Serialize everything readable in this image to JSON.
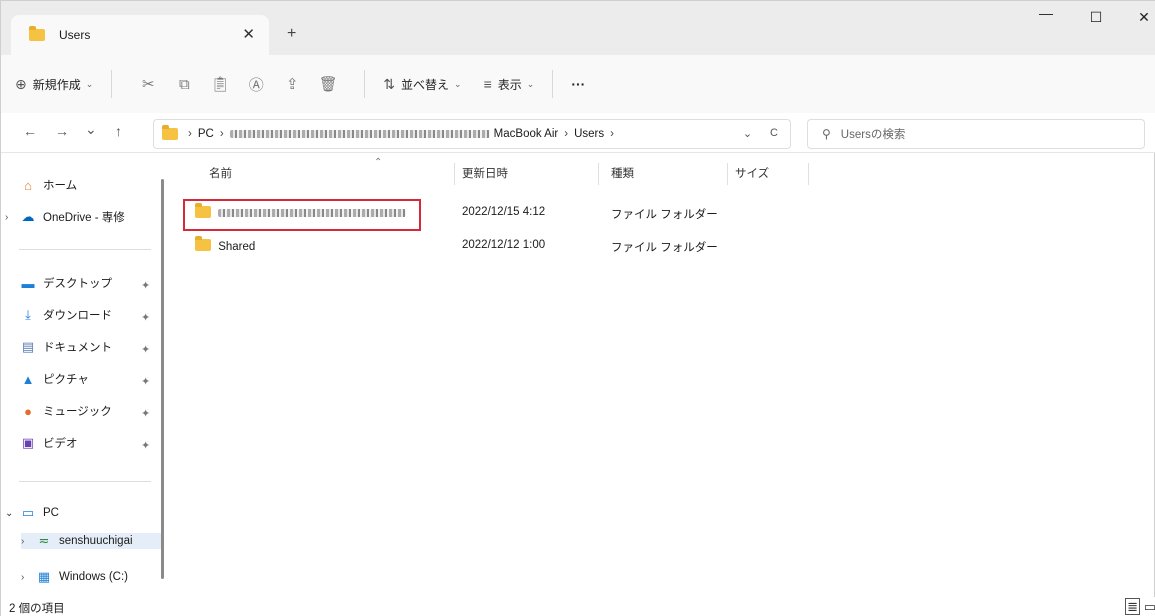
{
  "window": {
    "tab_title": "Users",
    "tab_close": "✕",
    "new_tab": "+",
    "minimize": "—",
    "maximize": "☐",
    "close": "✕"
  },
  "toolbar": {
    "new_label": "新規作成",
    "sort_label": "並べ替え",
    "view_label": "表示",
    "more_label": "···"
  },
  "address": {
    "back": "←",
    "forward": "→",
    "recent": "⌄",
    "up": "↑",
    "pc": "PC",
    "sep": "›",
    "device": "MacBook Air",
    "current": "Users",
    "refresh": "C",
    "dropdown": "⌄"
  },
  "search": {
    "placeholder": "Usersの検索"
  },
  "nav": {
    "home": "ホーム",
    "onedrive": "OneDrive - 専修",
    "desktop": "デスクトップ",
    "downloads": "ダウンロード",
    "documents": "ドキュメント",
    "pictures": "ピクチャ",
    "music": "ミュージック",
    "videos": "ビデオ",
    "pc": "PC",
    "user_drive": "senshuuchigai",
    "windows_drive": "Windows (C:)"
  },
  "columns": {
    "name": "名前",
    "modified": "更新日時",
    "type": "種類",
    "size": "サイズ"
  },
  "rows": [
    {
      "name": "",
      "modified": "2022/12/15 4:12",
      "type": "ファイル フォルダー"
    },
    {
      "name": "Shared",
      "modified": "2022/12/12 1:00",
      "type": "ファイル フォルダー"
    }
  ],
  "status": {
    "count": "2 個の項目"
  },
  "colors": {
    "accent": "#0067c0",
    "highlight_box": "#d7283a",
    "folder": "#f5c242"
  }
}
